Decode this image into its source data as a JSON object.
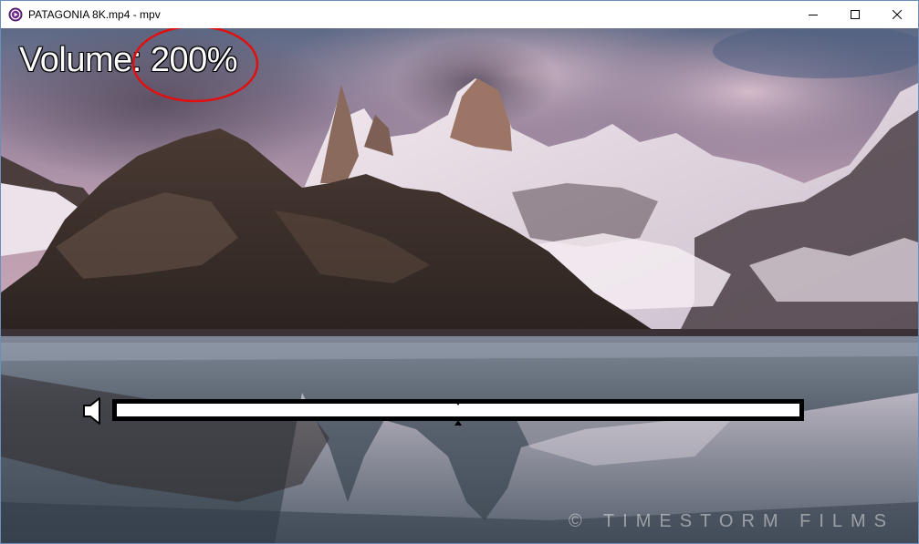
{
  "window": {
    "title": "PATAGONIA 8K.mp4 - mpv",
    "app_icon": "mpv-icon",
    "controls": {
      "minimize": "minimize-icon",
      "maximize": "maximize-icon",
      "close": "close-icon"
    }
  },
  "osd": {
    "volume_text": "Volume: 200%",
    "volume_level_fraction": 1.0,
    "volume_marker_fraction": 0.5,
    "speaker_icon": "speaker-icon",
    "highlight_color": "#e01010"
  },
  "video": {
    "watermark": "© TIMESTORM FILMS"
  },
  "colors": {
    "osd_text": "#ffffff",
    "osd_outline": "#000000",
    "window_border": "#6a8fbf"
  }
}
